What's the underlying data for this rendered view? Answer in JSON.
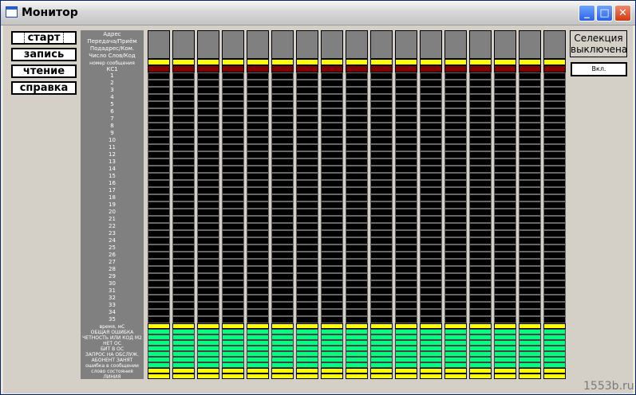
{
  "window": {
    "title": "Монитор",
    "controls": {
      "minimize": "_",
      "maximize": "□",
      "close": "✕"
    }
  },
  "menu": {
    "start": "старт",
    "write": "запись",
    "read": "чтение",
    "help": "справка"
  },
  "row_labels": {
    "header": [
      "Адрес",
      "Передача/Приём",
      "Подадрес/Ком.",
      "Число Слов/Код",
      "номер сообщения",
      "КС1"
    ],
    "data_words": [
      "1",
      "2",
      "3",
      "4",
      "5",
      "6",
      "7",
      "8",
      "9",
      "10",
      "11",
      "12",
      "13",
      "14",
      "15",
      "16",
      "17",
      "18",
      "19",
      "20",
      "21",
      "22",
      "23",
      "24",
      "25",
      "26",
      "27",
      "28",
      "29",
      "30",
      "31",
      "32",
      "33",
      "34",
      "35"
    ],
    "footer": [
      "время, мС",
      "ОБЩАЯ ОШИБКА",
      "ЧЁТНОСТЬ ИЛИ КОД М2",
      "НЕТ ОС",
      "БИТ В ОС",
      "ЗАПРОС НА ОБСЛУЖ.",
      "АБОНЕНТ ЗАНЯТ",
      "ошибка в сообщении",
      "слово состояния",
      "ЛИНИЯ"
    ]
  },
  "grid": {
    "column_count": 17,
    "colors": {
      "header": "#808080",
      "marker": "#ffff00",
      "cs1": "#800000",
      "data": "#000000",
      "status": "#00ff80"
    }
  },
  "selection": {
    "status": "Селекция выключена",
    "enable_button": "Вкл."
  },
  "watermark": "1553b.ru"
}
